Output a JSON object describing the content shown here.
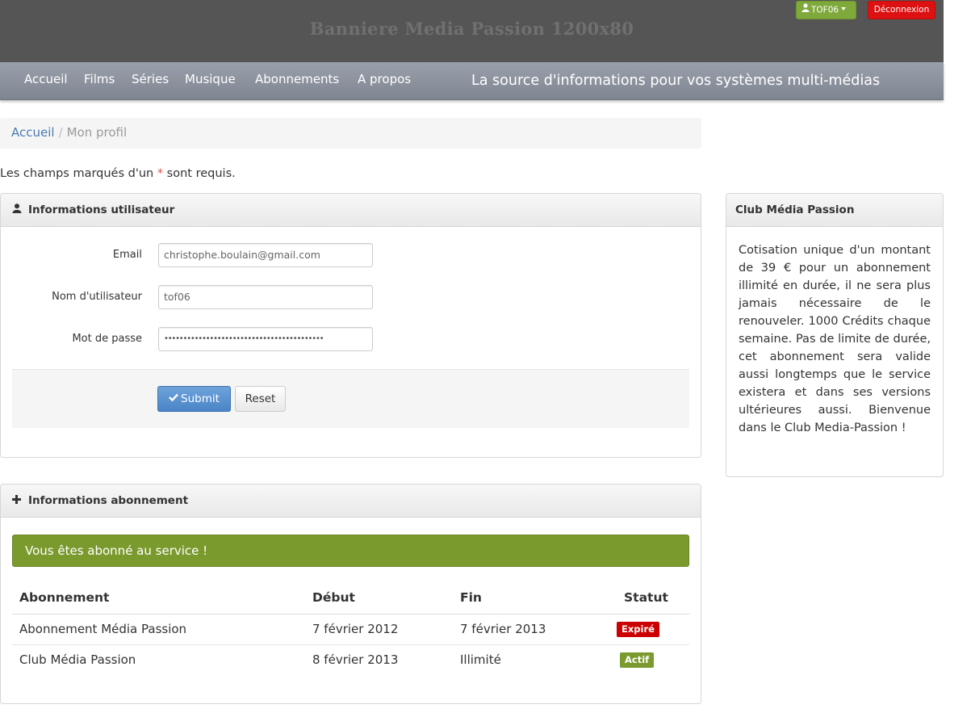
{
  "banner": {
    "title": "Banniere Media Passion 1200x80",
    "user_label": "TOF06",
    "logout_label": "Déconnexion"
  },
  "nav": {
    "items": [
      "Accueil",
      "Films",
      "Séries",
      "Musique",
      "Abonnements",
      "A propos"
    ],
    "tagline": "La source d'informations pour vos systèmes multi-médias"
  },
  "breadcrumb": {
    "home": "Accueil",
    "separator": "/",
    "current": "Mon profil"
  },
  "required_note": {
    "before": "Les champs marqués d'un ",
    "star": "*",
    "after": " sont requis."
  },
  "user_panel": {
    "title": "Informations utilisateur",
    "email_label": "Email",
    "email_value": "christophe.boulain@gmail.com",
    "username_label": "Nom d'utilisateur",
    "username_value": "tof06",
    "password_label": "Mot de passe",
    "password_value": "••••••••••••••••••••••••••••••••••••••••••",
    "submit_label": "Submit",
    "reset_label": "Reset"
  },
  "subscription_panel": {
    "title": "Informations abonnement",
    "alert": "Vous êtes abonné au service !",
    "columns": [
      "Abonnement",
      "Début",
      "Fin",
      "Statut"
    ],
    "rows": [
      {
        "name": "Abonnement Média Passion",
        "start": "7 février 2012",
        "end": "7 février 2013",
        "status": "Expiré"
      },
      {
        "name": "Club Média Passion",
        "start": "8 février 2013",
        "end": "Illimité",
        "status": "Actif"
      }
    ]
  },
  "club_panel": {
    "title": "Club Média Passion",
    "text": "Cotisation unique d'un montant de 39 € pour un abonnement illimité en durée, il ne sera plus jamais nécessaire de le renouveler. 1000 Crédits chaque semaine. Pas de limite de durée, cet abonnement sera valide aussi longtemps que le service existera et dans ses versions ultérieures aussi. Bienvenue dans le Club Media-Passion !"
  },
  "colors": {
    "banner_bg": "#555555",
    "nav_bg": "#8a909b",
    "user_button": "#7fa93b",
    "logout_button": "#dd1111",
    "link": "#4a7bb0",
    "success": "#7a9a2e",
    "danger": "#cc0000",
    "primary_button": "#5a93d1"
  },
  "icons": {
    "user": "user-icon",
    "plus": "plus-icon",
    "check": "check-icon",
    "caret": "caret-down-icon"
  }
}
